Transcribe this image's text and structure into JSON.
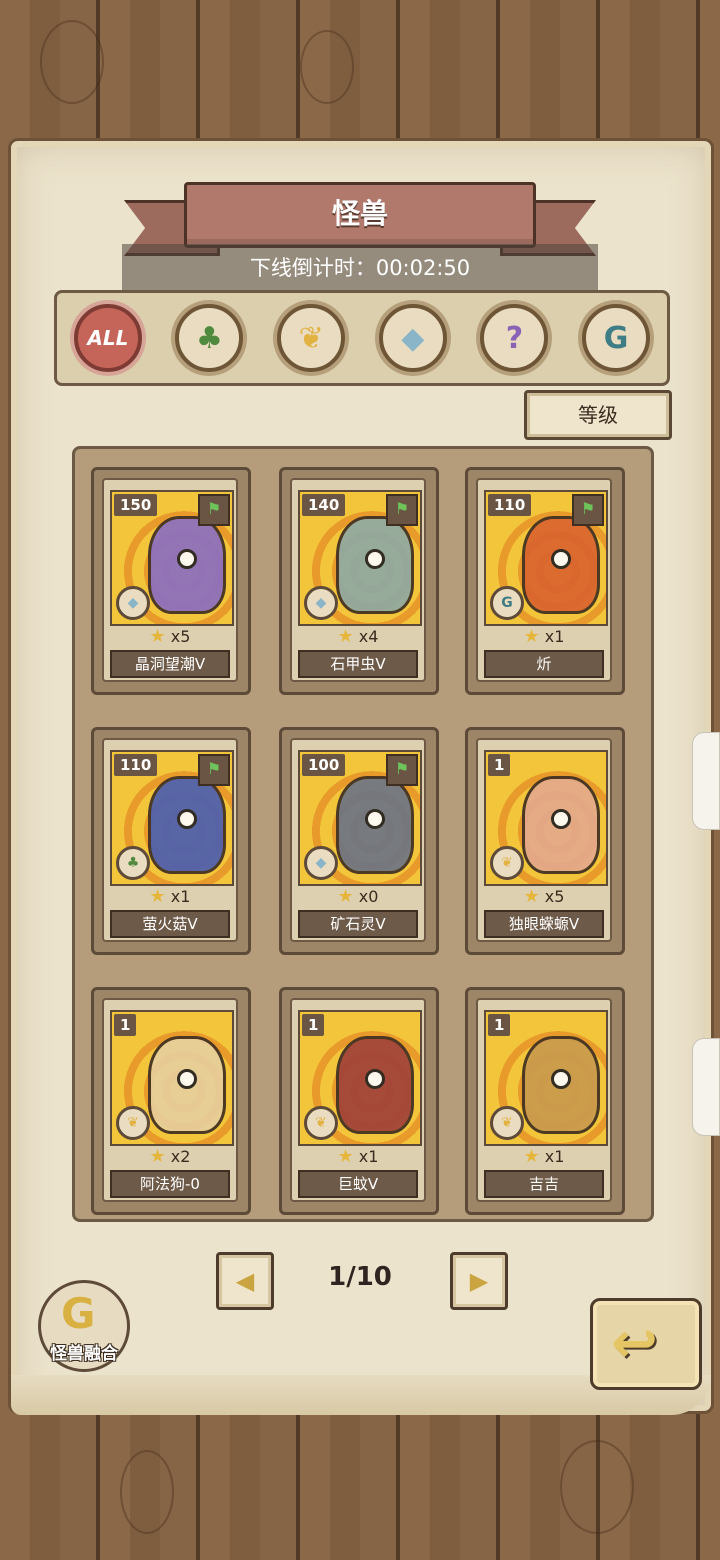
{
  "title": "怪兽",
  "countdown": "下线倒计时：00:02:50",
  "filters": [
    {
      "label": "ALL",
      "icon": "all"
    },
    {
      "label": "",
      "icon": "leaf-icon"
    },
    {
      "label": "",
      "icon": "paw-icon"
    },
    {
      "label": "",
      "icon": "crystal-icon"
    },
    {
      "label": "",
      "icon": "question-icon"
    },
    {
      "label": "",
      "icon": "swirl-icon"
    }
  ],
  "sort_label": "等级",
  "cards": [
    {
      "level": "150",
      "count": "x5",
      "name": "晶洞望潮V",
      "element": "crystal-icon",
      "color": "#8b6fc1"
    },
    {
      "level": "140",
      "count": "x4",
      "name": "石甲虫V",
      "element": "crystal-icon",
      "color": "#8fa9a3"
    },
    {
      "level": "110",
      "count": "x1",
      "name": "炘",
      "element": "swirl-icon",
      "color": "#d9642f"
    },
    {
      "level": "110",
      "count": "x1",
      "name": "萤火菇V",
      "element": "leaf-icon",
      "color": "#4b5fb0"
    },
    {
      "level": "100",
      "count": "x0",
      "name": "矿石灵V",
      "element": "crystal-icon",
      "color": "#6d7484"
    },
    {
      "level": "1",
      "count": "x5",
      "name": "独眼蝾螈V",
      "element": "paw-icon",
      "color": "#e3a98c"
    },
    {
      "level": "1",
      "count": "x2",
      "name": "阿法狗-0",
      "element": "paw-icon",
      "color": "#e7cf9c"
    },
    {
      "level": "1",
      "count": "x1",
      "name": "巨蚊V",
      "element": "paw-icon",
      "color": "#a0413a"
    },
    {
      "level": "1",
      "count": "x1",
      "name": "吉吉",
      "element": "paw-icon",
      "color": "#c99a4d"
    }
  ],
  "pagination": {
    "text": "1/10"
  },
  "fusion_label": "怪兽融合"
}
